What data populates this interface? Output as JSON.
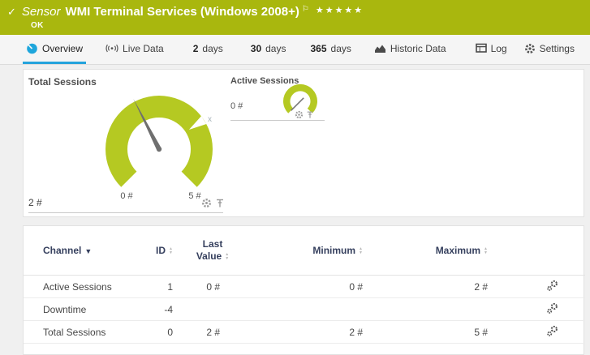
{
  "titlebar": {
    "status_icon": "✓",
    "kind": "Sensor",
    "title": "WMI Terminal Services (Windows 2008+)",
    "flag_icon": "⚐",
    "stars": "★★★★★",
    "status": "OK"
  },
  "tabs": {
    "overview": "Overview",
    "live": "Live Data",
    "d2_num": "2",
    "d2_label": "days",
    "d30_num": "30",
    "d30_label": "days",
    "d365_num": "365",
    "d365_label": "days",
    "historic": "Historic Data",
    "log": "Log",
    "settings": "Settings"
  },
  "gauges": {
    "total": {
      "title": "Total Sessions",
      "value": "2 #",
      "scale_min": "0 #",
      "scale_max": "5 #",
      "marker": "x",
      "reading": {
        "value": 2,
        "min": 0,
        "max": 5,
        "unit": "#"
      }
    },
    "active": {
      "title": "Active Sessions",
      "value": "0 #",
      "reading": {
        "value": 0,
        "unit": "#"
      }
    }
  },
  "table": {
    "headers": {
      "channel": "Channel",
      "id": "ID",
      "last_line1": "Last",
      "last_line2": "Value",
      "min": "Minimum",
      "max": "Maximum"
    },
    "rows": [
      {
        "channel": "Active Sessions",
        "id": "1",
        "last": "0 #",
        "min": "0 #",
        "max": "2 #"
      },
      {
        "channel": "Downtime",
        "id": "-4",
        "last": "",
        "min": "",
        "max": ""
      },
      {
        "channel": "Total Sessions",
        "id": "0",
        "last": "2 #",
        "min": "2 #",
        "max": "5 #"
      }
    ]
  },
  "colors": {
    "header_green": "#a9b70e",
    "gauge_green": "#b5c922",
    "accent_blue": "#24a3dc",
    "table_header_text": "#36405e"
  }
}
